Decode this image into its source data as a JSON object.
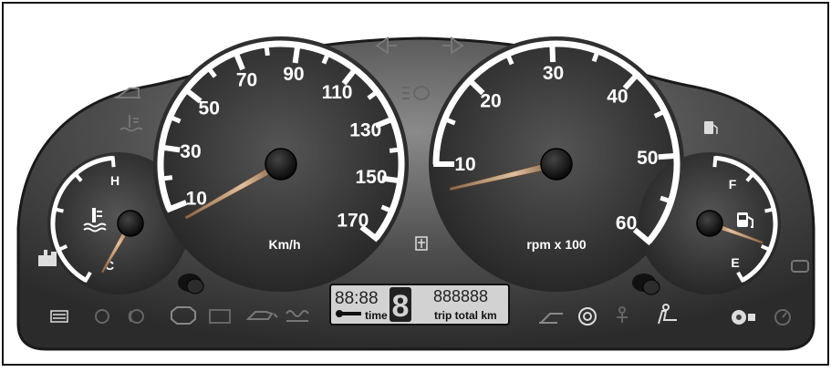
{
  "speedometer": {
    "labels": [
      "10",
      "30",
      "50",
      "70",
      "90",
      "110",
      "130",
      "150",
      "170"
    ],
    "unit": "Km/h",
    "needle_kmh": 5
  },
  "tachometer": {
    "labels": [
      "10",
      "20",
      "30",
      "40",
      "50",
      "60"
    ],
    "unit": "rpm x 100",
    "needle_rpm_x100": 7
  },
  "temperature_gauge": {
    "high_label": "H",
    "low_label": "C",
    "needle_level": 0.05
  },
  "fuel_gauge": {
    "full_label": "F",
    "empty_label": "E",
    "needle_level": 0.4
  },
  "lcd": {
    "time_digits": "88:88",
    "gear_digit": "8",
    "odometer_digits": "888888",
    "time_label": "time",
    "trip_label": "trip total km"
  },
  "colors": {
    "panel": "#3a3a3a",
    "panel_light": "#6c6c6c",
    "gauge_face": "#2a2a2a",
    "markings": "#ffffff",
    "needle": "#c9a27c",
    "lcd": "#d2d2d2"
  },
  "icons": [
    "door-open-icon",
    "coolant-temp-icon",
    "seat-belt-icon",
    "battery-icon",
    "abs-icon",
    "brake-icon",
    "engine-check-icon",
    "oil-pressure-icon",
    "glow-plug-icon",
    "turn-left-icon",
    "turn-right-icon",
    "high-beam-icon",
    "hazard-icon",
    "fuel-pump-icon",
    "park-brake-icon",
    "airbag-icon",
    "service-icon",
    "washer-fluid-icon",
    "speedometer-small-icon",
    "trip-reset-knob-icon"
  ]
}
